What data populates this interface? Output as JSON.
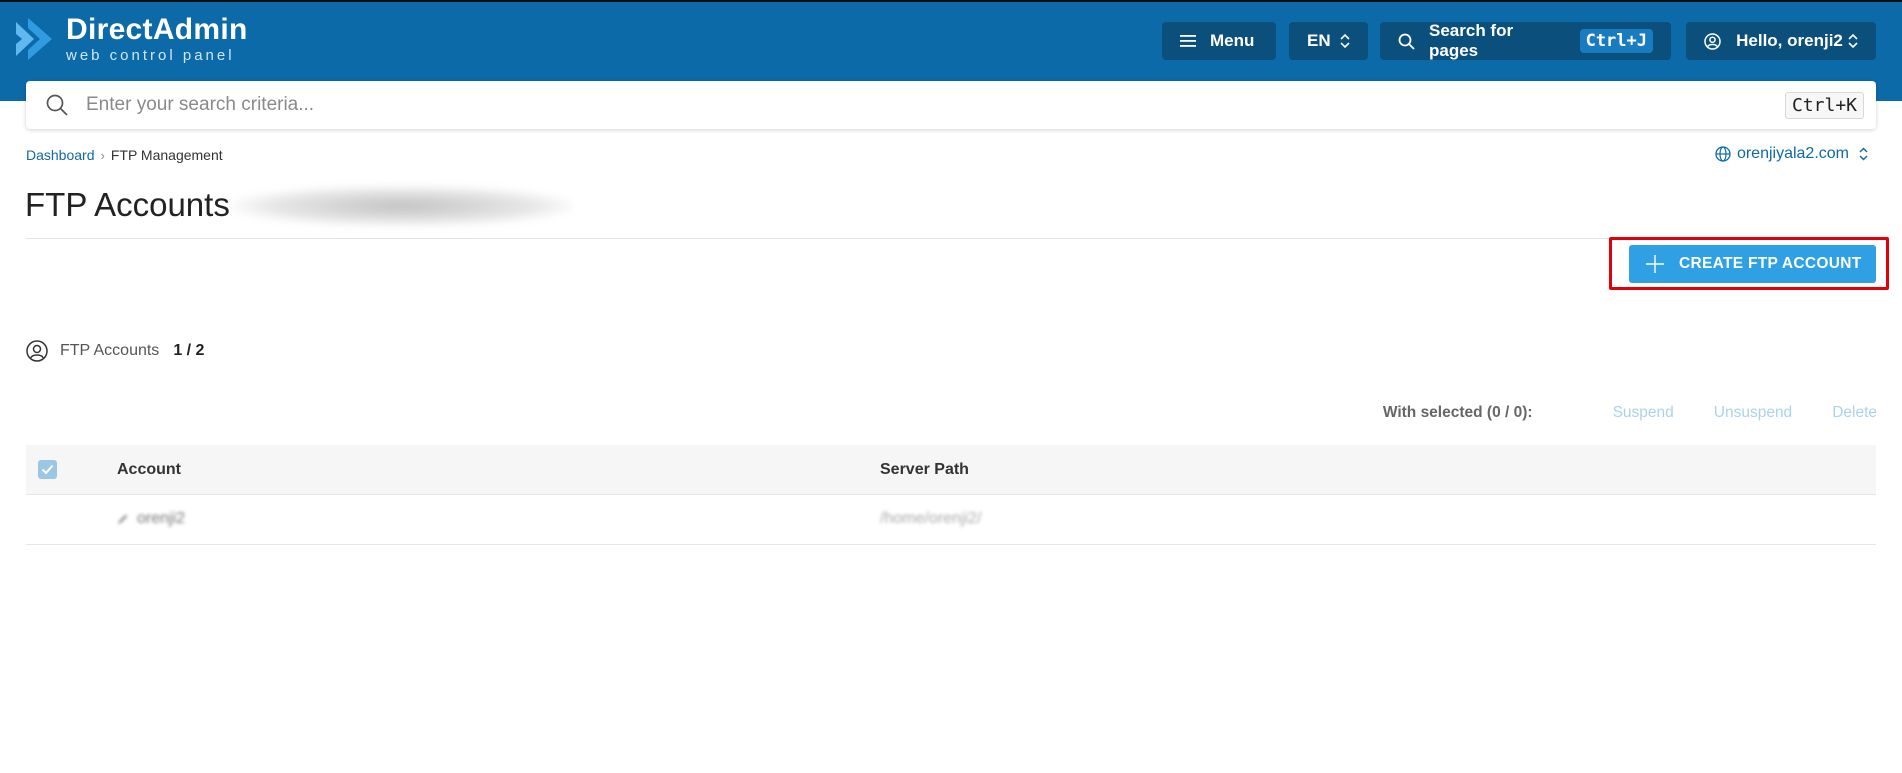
{
  "header": {
    "logo_title": "DirectAdmin",
    "logo_subtitle": "web control panel",
    "menu_label": "Menu",
    "language": "EN",
    "search_pages_label": "Search for pages",
    "search_pages_shortcut": "Ctrl+J",
    "user_greeting": "Hello, orenji2"
  },
  "search": {
    "placeholder": "Enter your search criteria...",
    "shortcut": "Ctrl+K"
  },
  "breadcrumb": {
    "home": "Dashboard",
    "current": "FTP Management"
  },
  "domain_selector": {
    "value": "orenjiyala2.com"
  },
  "page": {
    "title": "FTP Accounts"
  },
  "actions": {
    "create_label": "CREATE FTP ACCOUNT"
  },
  "counter": {
    "label": "FTP Accounts",
    "value": "1 / 2"
  },
  "bulk": {
    "label": "With selected (0 / 0):",
    "suspend": "Suspend",
    "unsuspend": "Unsuspend",
    "delete": "Delete"
  },
  "table": {
    "columns": {
      "account": "Account",
      "server_path": "Server Path"
    },
    "rows": [
      {
        "account": "orenji2",
        "server_path": "/home/orenji2/"
      }
    ]
  },
  "colors": {
    "header_bg": "#0d6aa8",
    "header_button_bg": "#0b4f7d",
    "primary_button": "#2ea0e3",
    "highlight_border": "#e2000b",
    "link": "#0d6aa8"
  }
}
